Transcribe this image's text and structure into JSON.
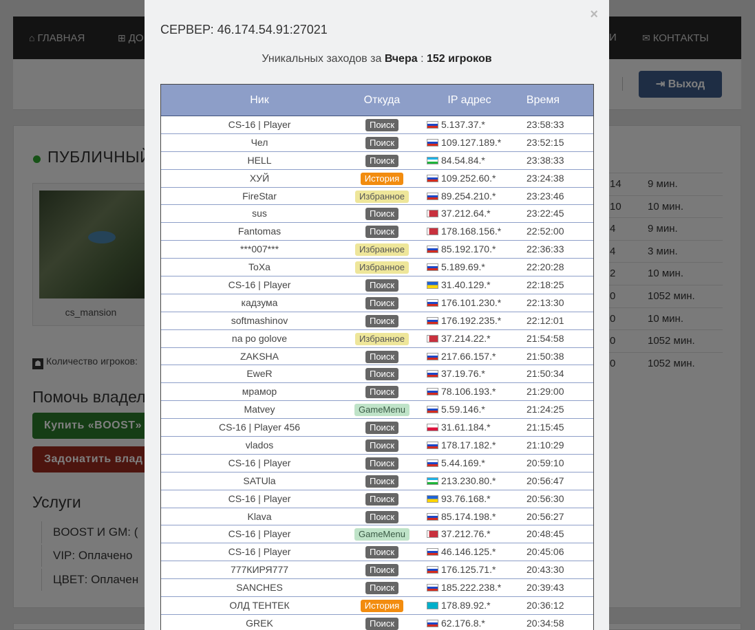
{
  "background": {
    "nav": {
      "home": "ГЛАВНАЯ",
      "add": "ДО",
      "contacts": "КОНТАКТЫ",
      "partial": "И"
    },
    "exit_button": "Выход",
    "panel_title": "ПУБЛИЧНЫЙ",
    "map_name": "cs_mansion",
    "players_label": "Количество игроков:",
    "help_title": "Помочь владел",
    "buy_boost": "Купить «BOOST»",
    "donate": "Задонатить влад",
    "services_title": "Услуги",
    "services": [
      "BOOST И GM:  (",
      "VIP:  Оплачено",
      "ЦВЕТ:  Оплачен"
    ],
    "right_list": [
      {
        "a": "14",
        "b": "9 мин."
      },
      {
        "a": "10",
        "b": "10 мин."
      },
      {
        "a": "4",
        "b": "9 мин."
      },
      {
        "a": "4",
        "b": "3 мин."
      },
      {
        "a": "2",
        "b": "10 мин."
      },
      {
        "a": "0",
        "b": "1052 мин."
      },
      {
        "a": "0",
        "b": "10 мин."
      },
      {
        "a": "0",
        "b": "1052 мин."
      },
      {
        "a": "0",
        "b": "1052 мин."
      }
    ]
  },
  "modal": {
    "title": "СЕРВЕР: 46.174.54.91:27021",
    "subtitle_prefix": "Уникальных заходов за ",
    "subtitle_day": "Вчера",
    "subtitle_sep": " : ",
    "subtitle_count": "152 игроков",
    "close": "×",
    "columns": {
      "nick": "Ник",
      "source": "Откуда",
      "ip": "IP адрес",
      "time": "Время"
    },
    "badge_colors": {
      "Поиск": {
        "bg": "#666666",
        "fg": "#ffffff"
      },
      "История": {
        "bg": "#f28c0f",
        "fg": "#ffffff"
      },
      "Избранное": {
        "bg": "#eee69a",
        "fg": "#555555"
      },
      "GameMenu": {
        "bg": "#bfe3c8",
        "fg": "#3a5a45"
      }
    },
    "rows": [
      {
        "nick": "CS-16 | Player",
        "source": "Поиск",
        "flag": "ru",
        "ip": "5.137.37.*",
        "time": "23:58:33"
      },
      {
        "nick": "Чел",
        "source": "Поиск",
        "flag": "ru",
        "ip": "109.127.189.*",
        "time": "23:52:15"
      },
      {
        "nick": "HELL",
        "source": "Поиск",
        "flag": "uz",
        "ip": "84.54.84.*",
        "time": "23:38:33"
      },
      {
        "nick": "ХУЙ",
        "source": "История",
        "flag": "ru",
        "ip": "109.252.60.*",
        "time": "23:24:38"
      },
      {
        "nick": "FireStar",
        "source": "Избранное",
        "flag": "ru",
        "ip": "89.254.210.*",
        "time": "23:23:46"
      },
      {
        "nick": "sus",
        "source": "Поиск",
        "flag": "by",
        "ip": "37.212.64.*",
        "time": "23:22:45"
      },
      {
        "nick": "Fantomas",
        "source": "Поиск",
        "flag": "by",
        "ip": "178.168.156.*",
        "time": "22:52:00"
      },
      {
        "nick": "***007***",
        "source": "Избранное",
        "flag": "ru",
        "ip": "85.192.170.*",
        "time": "22:36:33"
      },
      {
        "nick": "ToXa",
        "source": "Избранное",
        "flag": "ru",
        "ip": "5.189.69.*",
        "time": "22:20:28"
      },
      {
        "nick": "CS-16 | Player",
        "source": "Поиск",
        "flag": "ua",
        "ip": "31.40.129.*",
        "time": "22:18:25"
      },
      {
        "nick": "кадзума",
        "source": "Поиск",
        "flag": "ru",
        "ip": "176.101.230.*",
        "time": "22:13:30"
      },
      {
        "nick": "softmashinov",
        "source": "Поиск",
        "flag": "ru",
        "ip": "176.192.235.*",
        "time": "22:12:01"
      },
      {
        "nick": "na po golove",
        "source": "Избранное",
        "flag": "by",
        "ip": "37.214.22.*",
        "time": "21:54:58"
      },
      {
        "nick": "ZAKSHA",
        "source": "Поиск",
        "flag": "ru",
        "ip": "217.66.157.*",
        "time": "21:50:38"
      },
      {
        "nick": "EweR",
        "source": "Поиск",
        "flag": "ru",
        "ip": "37.19.76.*",
        "time": "21:50:34"
      },
      {
        "nick": "мрамор",
        "source": "Поиск",
        "flag": "ru",
        "ip": "78.106.193.*",
        "time": "21:29:00"
      },
      {
        "nick": "Matvey",
        "source": "GameMenu",
        "flag": "ru",
        "ip": "5.59.146.*",
        "time": "21:24:25"
      },
      {
        "nick": "CS-16 | Player 456",
        "source": "Поиск",
        "flag": "pl",
        "ip": "31.61.184.*",
        "time": "21:15:45"
      },
      {
        "nick": "vlados",
        "source": "Поиск",
        "flag": "ru",
        "ip": "178.17.182.*",
        "time": "21:10:29"
      },
      {
        "nick": "CS-16 | Player",
        "source": "Поиск",
        "flag": "ru",
        "ip": "5.44.169.*",
        "time": "20:59:10"
      },
      {
        "nick": "SATUla",
        "source": "Поиск",
        "flag": "uz",
        "ip": "213.230.80.*",
        "time": "20:56:47"
      },
      {
        "nick": "CS-16 | Player",
        "source": "Поиск",
        "flag": "ua",
        "ip": "93.76.168.*",
        "time": "20:56:30"
      },
      {
        "nick": "Klava",
        "source": "Поиск",
        "flag": "ru",
        "ip": "85.174.198.*",
        "time": "20:56:27"
      },
      {
        "nick": "CS-16 | Player",
        "source": "GameMenu",
        "flag": "by",
        "ip": "37.212.76.*",
        "time": "20:48:45"
      },
      {
        "nick": "CS-16 | Player",
        "source": "Поиск",
        "flag": "ru",
        "ip": "46.146.125.*",
        "time": "20:45:06"
      },
      {
        "nick": "777КИРЯ777",
        "source": "Поиск",
        "flag": "ru",
        "ip": "176.125.71.*",
        "time": "20:43:30"
      },
      {
        "nick": "SANCHES",
        "source": "Поиск",
        "flag": "ru",
        "ip": "185.222.238.*",
        "time": "20:39:43"
      },
      {
        "nick": "ОЛД ТЕНТЕК",
        "source": "История",
        "flag": "kz",
        "ip": "178.89.92.*",
        "time": "20:36:12"
      },
      {
        "nick": "GREK",
        "source": "Поиск",
        "flag": "ru",
        "ip": "62.176.8.*",
        "time": "20:34:58"
      }
    ]
  }
}
